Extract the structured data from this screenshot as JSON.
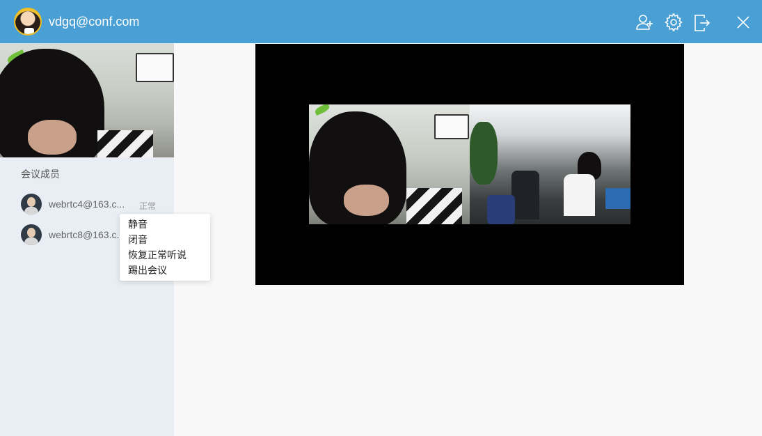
{
  "header": {
    "user_email": "vdgq@conf.com"
  },
  "sidebar": {
    "members_title": "会议成员",
    "members": [
      {
        "name": "webrtc4@163.c...",
        "status": "正常"
      },
      {
        "name": "webrtc8@163.c..."
      }
    ]
  },
  "context_menu": {
    "items": [
      "静音",
      "闭音",
      "恢复正常听说",
      "踢出会议"
    ]
  },
  "colors": {
    "titlebar": "#4a9fd5",
    "sidebar_bg": "#e8eef3",
    "main_bg": "#f8f8f8",
    "video_bg": "#000000"
  },
  "icons": {
    "titlebar_buttons": [
      "add-member-icon",
      "settings-gear-icon",
      "exit-meeting-icon",
      "close-icon"
    ]
  }
}
